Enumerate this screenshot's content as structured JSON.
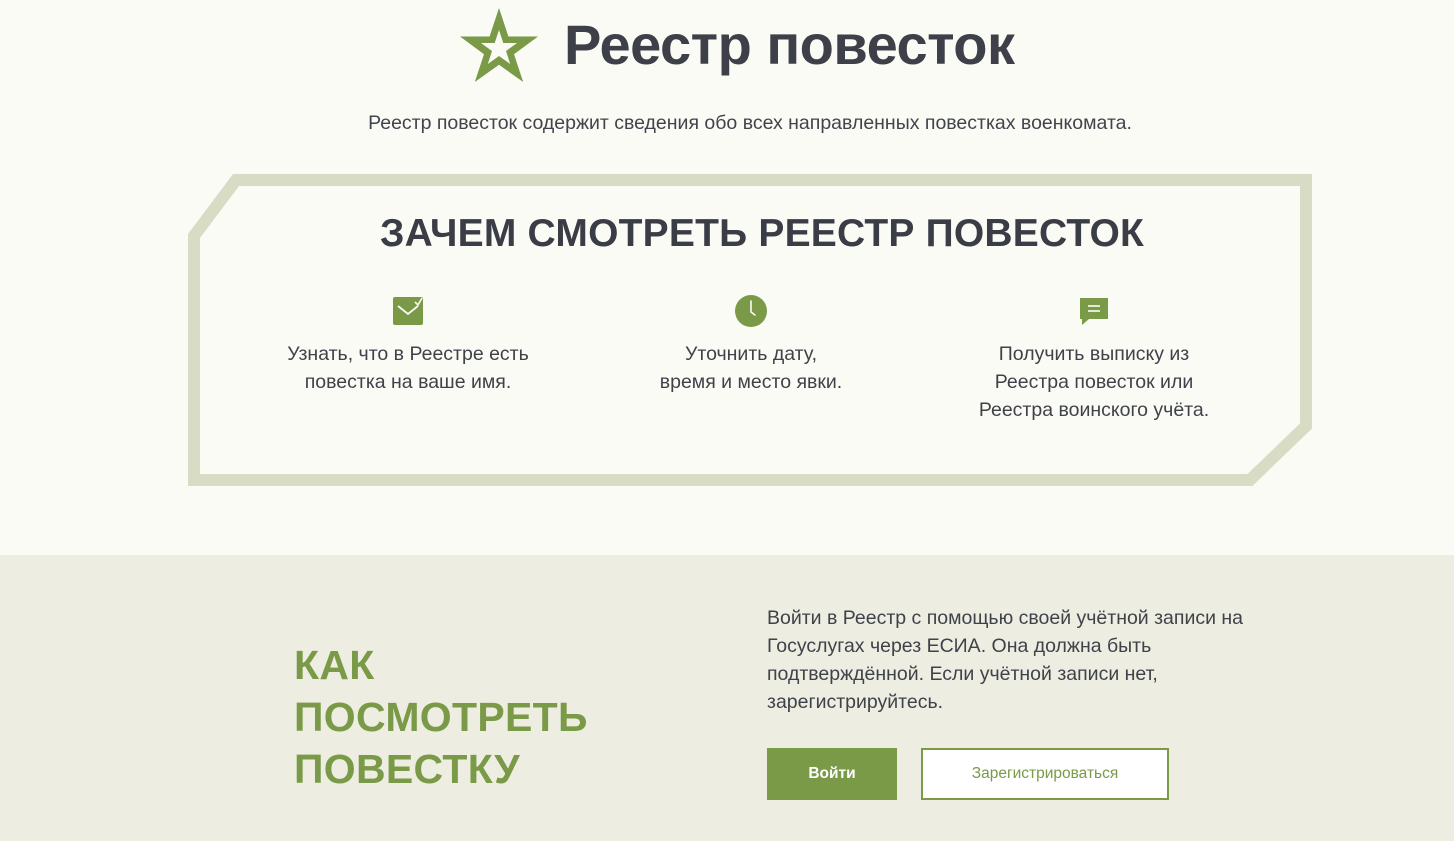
{
  "header": {
    "title": "Реестр повесток",
    "subtitle": "Реестр повесток содержит сведения обо всех направленных повестках военкомата.",
    "logo_icon": "star-emblem-icon"
  },
  "why": {
    "title": "ЗАЧЕМ СМОТРЕТЬ РЕЕСТР ПОВЕСТОК",
    "features": [
      {
        "icon": "checked-envelope-icon",
        "text": "Узнать, что в Реестре есть\nповестка на ваше имя."
      },
      {
        "icon": "clock-icon",
        "text": "Уточнить дату,\nвремя и место явки."
      },
      {
        "icon": "chat-bubble-icon",
        "text": "Получить выписку из\nРеестра повесток или\nРеестра воинского учёта."
      }
    ]
  },
  "how": {
    "title": "КАК\nПОСМОТРЕТЬ\nПОВЕСТКУ",
    "description": "Войти в Реестр с помощью своей учётной записи на Госуслугах через ЕСИА. Она должна быть подтверждённой. Если учётной записи нет, зарегистрируйтесь.",
    "login_label": "Войти",
    "register_label": "Зарегистрироваться"
  },
  "colors": {
    "accent": "#7a9a48",
    "frame": "#d9dcc5",
    "section_bg": "#edede1",
    "page_bg": "#fbfbf6",
    "text": "#3a3d46"
  }
}
